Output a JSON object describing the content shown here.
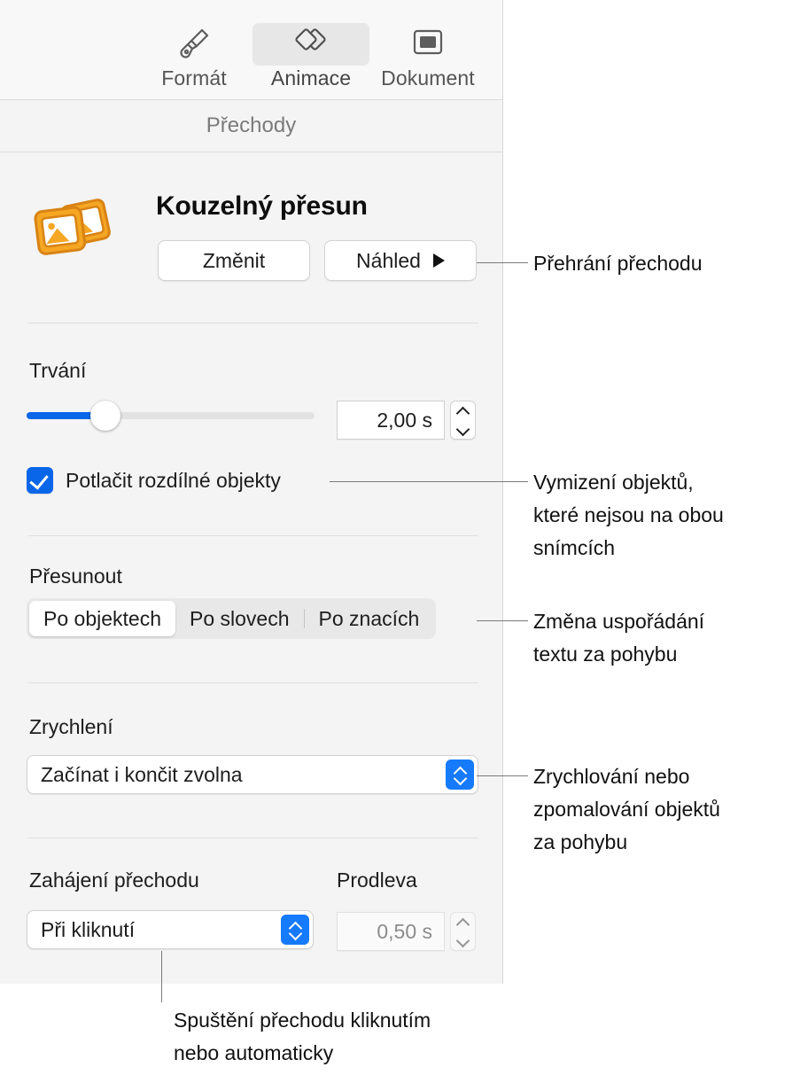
{
  "tabs": [
    {
      "label": "Formát",
      "icon": "paintbrush-icon",
      "selected": false
    },
    {
      "label": "Animace",
      "icon": "transition-diamonds-icon",
      "selected": true
    },
    {
      "label": "Dokument",
      "icon": "document-rect-icon",
      "selected": false
    }
  ],
  "section": {
    "title": "Přechody"
  },
  "transition": {
    "icon": "magic-move-photos-icon",
    "name": "Kouzelný přesun",
    "change_label": "Změnit",
    "preview_label": "Náhled",
    "preview_icon": "play-triangle-icon"
  },
  "duration": {
    "label": "Trvání",
    "value": "2,00 s",
    "slider_percent": 25
  },
  "suppress": {
    "label": "Potlačit rozdílné objekty",
    "checked": true
  },
  "move": {
    "label": "Přesunout",
    "options": [
      "Po objektech",
      "Po slovech",
      "Po znacích"
    ],
    "selected_index": 0
  },
  "acceleration": {
    "label": "Zrychlení",
    "value": "Začínat i končit zvolna"
  },
  "start": {
    "label": "Zahájení přechodu",
    "value": "Při kliknutí"
  },
  "delay": {
    "label": "Prodleva",
    "value": "0,50 s",
    "enabled": false
  },
  "callouts": {
    "preview": "Přehrání přechodu",
    "suppress": "Vymizení objektů,\nkteré nejsou na obou\nsnímcích",
    "move": "Změna uspořádání\ntextu za pohybu",
    "acceleration": "Zrychlování nebo\nzpomalování objektů\nza pohybu",
    "start": "Spuštění přechodu kliknutím\nnebo automaticky"
  },
  "colors": {
    "accent_blue": "#0a66e8",
    "popup_blue": "#157afb",
    "panel_bg": "#f4f4f4",
    "icon_orange": "#E8912B"
  }
}
